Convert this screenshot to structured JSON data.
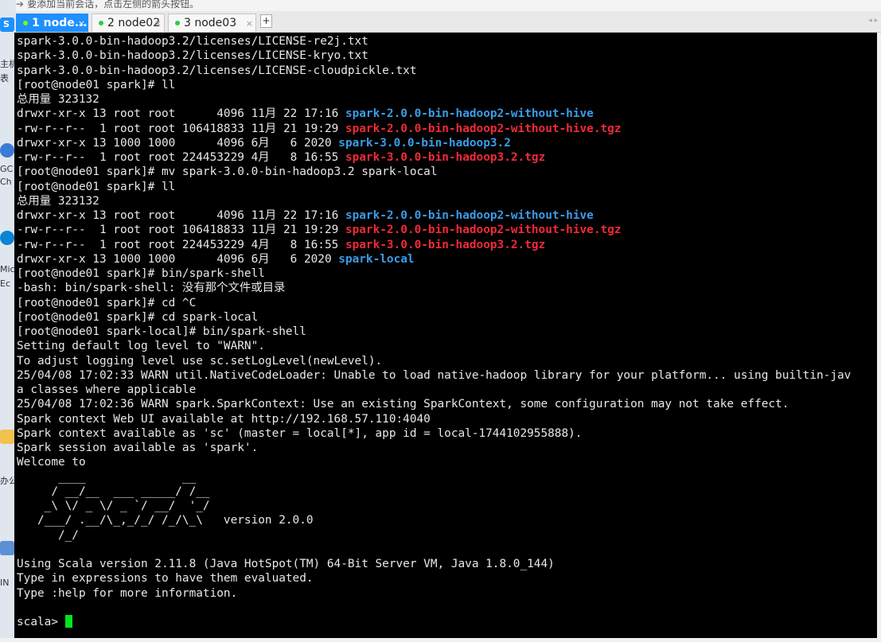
{
  "hint": {
    "text": "要添加当前会话，点击左侧的箭头按钮。"
  },
  "side": {
    "labels": [
      "S",
      "主机",
      "表",
      "GC",
      "Ch",
      "Mic",
      "Ec",
      "办公",
      "IN"
    ]
  },
  "tabs": [
    {
      "label": "1 node...",
      "active": true
    },
    {
      "label": "2 node02",
      "active": false
    },
    {
      "label": "3 node03",
      "active": false
    }
  ],
  "add_tab": "+",
  "colors": {
    "directory": "#3c9be8",
    "archive": "#f02a3a",
    "cursor": "#00e61c",
    "active_tab": "#1e90ff"
  },
  "terminal": {
    "lines": [
      "spark-3.0.0-bin-hadoop3.2/licenses/LICENSE-re2j.txt",
      "spark-3.0.0-bin-hadoop3.2/licenses/LICENSE-kryo.txt",
      "spark-3.0.0-bin-hadoop3.2/licenses/LICENSE-cloudpickle.txt",
      "[root@node01 spark]# ll",
      "总用量 323132",
      {
        "p": "drwxr-xr-x 13 root root      4096 11月 22 17:16 ",
        "h": "spark-2.0.0-bin-hadoop2-without-hive",
        "c": "dir"
      },
      {
        "p": "-rw-r--r--  1 root root 106418833 11月 21 19:29 ",
        "h": "spark-2.0.0-bin-hadoop2-without-hive.tgz",
        "c": "tgz"
      },
      {
        "p": "drwxr-xr-x 13 1000 1000      4096 6月   6 2020 ",
        "h": "spark-3.0.0-bin-hadoop3.2",
        "c": "dir"
      },
      {
        "p": "-rw-r--r--  1 root root 224453229 4月   8 16:55 ",
        "h": "spark-3.0.0-bin-hadoop3.2.tgz",
        "c": "tgz"
      },
      "[root@node01 spark]# mv spark-3.0.0-bin-hadoop3.2 spark-local",
      "[root@node01 spark]# ll",
      "总用量 323132",
      {
        "p": "drwxr-xr-x 13 root root      4096 11月 22 17:16 ",
        "h": "spark-2.0.0-bin-hadoop2-without-hive",
        "c": "dir"
      },
      {
        "p": "-rw-r--r--  1 root root 106418833 11月 21 19:29 ",
        "h": "spark-2.0.0-bin-hadoop2-without-hive.tgz",
        "c": "tgz"
      },
      {
        "p": "-rw-r--r--  1 root root 224453229 4月   8 16:55 ",
        "h": "spark-3.0.0-bin-hadoop3.2.tgz",
        "c": "tgz"
      },
      {
        "p": "drwxr-xr-x 13 1000 1000      4096 6月   6 2020 ",
        "h": "spark-local",
        "c": "dir"
      },
      "[root@node01 spark]# bin/spark-shell",
      "-bash: bin/spark-shell: 没有那个文件或目录",
      "[root@node01 spark]# cd ^C",
      "[root@node01 spark]# cd spark-local",
      "[root@node01 spark-local]# bin/spark-shell",
      "Setting default log level to \"WARN\".",
      "To adjust logging level use sc.setLogLevel(newLevel).",
      "25/04/08 17:02:33 WARN util.NativeCodeLoader: Unable to load native-hadoop library for your platform... using builtin-jav",
      "a classes where applicable",
      "25/04/08 17:02:36 WARN spark.SparkContext: Use an existing SparkContext, some configuration may not take effect.",
      "Spark context Web UI available at http://192.168.57.110:4040",
      "Spark context available as 'sc' (master = local[*], app id = local-1744102955888).",
      "Spark session available as 'spark'.",
      "Welcome to",
      "      ____              __",
      "     / __/__  ___ _____/ /__",
      "    _\\ \\/ _ \\/ _ `/ __/  '_/",
      "   /___/ .__/\\_,_/_/ /_/\\_\\   version 2.0.0",
      "      /_/",
      "",
      "Using Scala version 2.11.8 (Java HotSpot(TM) 64-Bit Server VM, Java 1.8.0_144)",
      "Type in expressions to have them evaluated.",
      "Type :help for more information.",
      "",
      "scala> "
    ]
  }
}
